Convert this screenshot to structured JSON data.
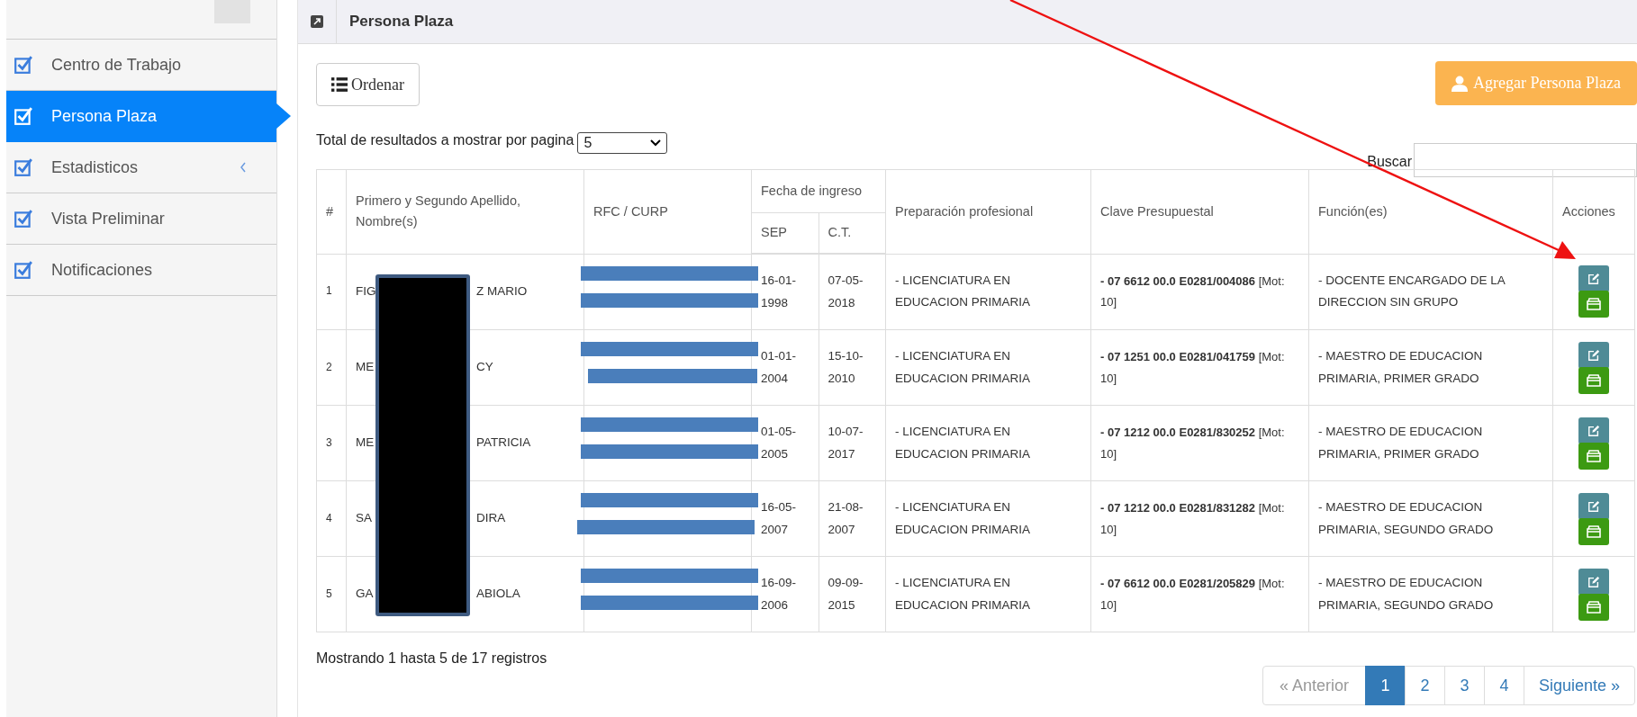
{
  "sidebar": {
    "items": [
      {
        "label": "Centro de Trabajo",
        "selected": false,
        "expandable": false
      },
      {
        "label": "Persona Plaza",
        "selected": true,
        "expandable": false
      },
      {
        "label": "Estadisticos",
        "selected": false,
        "expandable": true
      },
      {
        "label": "Vista Preliminar",
        "selected": false,
        "expandable": false
      },
      {
        "label": "Notificaciones",
        "selected": false,
        "expandable": false
      }
    ]
  },
  "panel": {
    "title": "Persona Plaza",
    "sort_button": "Ordenar",
    "add_button": "Agregar Persona Plaza",
    "page_size": {
      "label": "Total de resultados a mostrar por pagina",
      "value": "5"
    },
    "search": {
      "label": "Buscar"
    },
    "table": {
      "columns": {
        "number": "#",
        "name": "Primero y Segundo Apellido, Nombre(s)",
        "rfc": "RFC / CURP",
        "date_group": "Fecha de ingreso",
        "sep": "SEP",
        "ct": "C.T.",
        "preparation": "Preparación profesional",
        "key": "Clave Presupuestal",
        "function": "Función(es)",
        "actions": "Acciones"
      },
      "rows": [
        {
          "number": "1",
          "name_start": "FIG",
          "name_end": "Z MARIO",
          "sep": "16-01-1998",
          "ct": "07-05-2018",
          "preparation": "- LICENCIATURA EN EDUCACION PRIMARIA",
          "key": "**- 07 6612 00.0 E0281/004086** [Mot: 10]",
          "function": "- DOCENTE ENCARGADO DE LA DIRECCION SIN GRUPO"
        },
        {
          "number": "2",
          "name_start": "ME",
          "name_end": "CY",
          "sep": "01-01-2004",
          "ct": "15-10-2010",
          "preparation": "- LICENCIATURA EN EDUCACION PRIMARIA",
          "key": "**- 07 1251 00.0 E0281/041759** [Mot: 10]",
          "function": "- MAESTRO DE EDUCACION PRIMARIA, PRIMER GRADO"
        },
        {
          "number": "3",
          "name_start": "ME",
          "name_end": "PATRICIA",
          "sep": "01-05-2005",
          "ct": "10-07-2017",
          "preparation": "- LICENCIATURA EN EDUCACION PRIMARIA",
          "key": "**- 07 1212 00.0 E0281/830252** [Mot: 10]",
          "function": "- MAESTRO DE EDUCACION PRIMARIA, PRIMER GRADO"
        },
        {
          "number": "4",
          "name_start": "SA",
          "name_end": "DIRA",
          "sep": "16-05-2007",
          "ct": "21-08-2007",
          "preparation": "- LICENCIATURA EN EDUCACION PRIMARIA",
          "key": "**- 07 1212 00.0 E0281/831282** [Mot: 10]",
          "function": "- MAESTRO DE EDUCACION PRIMARIA, SEGUNDO GRADO"
        },
        {
          "number": "5",
          "name_start": "GA",
          "name_end": "ABIOLA",
          "sep": "16-09-2006",
          "ct": "09-09-2015",
          "preparation": "- LICENCIATURA EN EDUCACION PRIMARIA",
          "key": "**- 07 6612 00.0 E0281/205829** [Mot: 10]",
          "function": "- MAESTRO DE EDUCACION PRIMARIA, SEGUNDO GRADO"
        }
      ]
    },
    "summary": "Mostrando 1 hasta 5 de 17 registros",
    "pagination": {
      "previous": "« Anterior",
      "pages": [
        {
          "label": "1",
          "selected": true
        },
        {
          "label": "2",
          "selected": false
        },
        {
          "label": "3",
          "selected": false
        },
        {
          "label": "4",
          "selected": false
        }
      ],
      "next": "Siguiente »"
    }
  }
}
